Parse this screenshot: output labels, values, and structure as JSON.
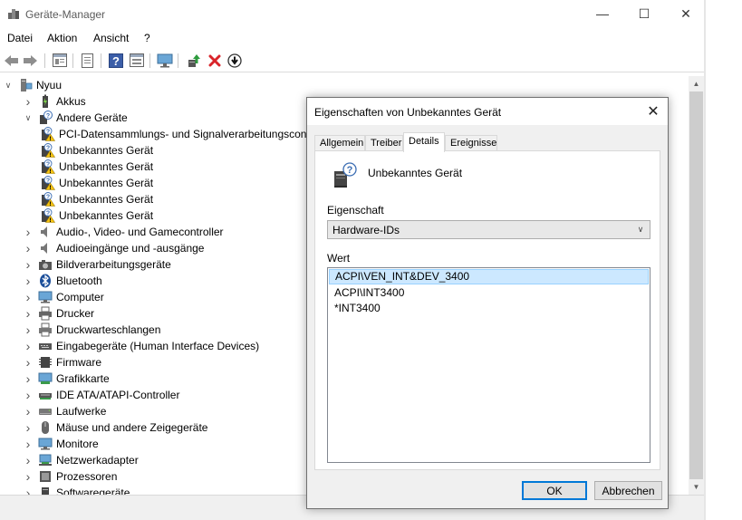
{
  "window": {
    "title": "Geräte-Manager",
    "minimize": "—",
    "maximize": "☐",
    "close": "✕"
  },
  "menu": [
    "Datei",
    "Aktion",
    "Ansicht",
    "?"
  ],
  "toolbar": [
    "back-arrow-icon",
    "forward-arrow-icon",
    "properties-view-icon",
    "document-icon",
    "help-icon",
    "update-view-icon",
    "monitor-icon",
    "driver-update-icon",
    "uninstall-x-icon",
    "download-icon"
  ],
  "tree": {
    "root": "Nyuu",
    "items": [
      {
        "label": "Akkus",
        "level": 1,
        "expanded": false
      },
      {
        "label": "Andere Geräte",
        "level": 1,
        "expanded": true
      },
      {
        "label": "PCI-Datensammlungs- und Signalverarbeitungscontroller",
        "level": 2,
        "warning": true
      },
      {
        "label": "Unbekanntes Gerät",
        "level": 2,
        "warning": true
      },
      {
        "label": "Unbekanntes Gerät",
        "level": 2,
        "warning": true
      },
      {
        "label": "Unbekanntes Gerät",
        "level": 2,
        "warning": true
      },
      {
        "label": "Unbekanntes Gerät",
        "level": 2,
        "warning": true
      },
      {
        "label": "Unbekanntes Gerät",
        "level": 2,
        "warning": true
      },
      {
        "label": "Audio-, Video- und Gamecontroller",
        "level": 1,
        "expanded": false
      },
      {
        "label": "Audioeingänge und -ausgänge",
        "level": 1,
        "expanded": false
      },
      {
        "label": "Bildverarbeitungsgeräte",
        "level": 1,
        "expanded": false
      },
      {
        "label": "Bluetooth",
        "level": 1,
        "expanded": false
      },
      {
        "label": "Computer",
        "level": 1,
        "expanded": false
      },
      {
        "label": "Drucker",
        "level": 1,
        "expanded": false
      },
      {
        "label": "Druckwarteschlangen",
        "level": 1,
        "expanded": false
      },
      {
        "label": "Eingabegeräte (Human Interface Devices)",
        "level": 1,
        "expanded": false
      },
      {
        "label": "Firmware",
        "level": 1,
        "expanded": false
      },
      {
        "label": "Grafikkarte",
        "level": 1,
        "expanded": false
      },
      {
        "label": "IDE ATA/ATAPI-Controller",
        "level": 1,
        "expanded": false
      },
      {
        "label": "Laufwerke",
        "level": 1,
        "expanded": false
      },
      {
        "label": "Mäuse und andere Zeigegeräte",
        "level": 1,
        "expanded": false
      },
      {
        "label": "Monitore",
        "level": 1,
        "expanded": false
      },
      {
        "label": "Netzwerkadapter",
        "level": 1,
        "expanded": false
      },
      {
        "label": "Prozessoren",
        "level": 1,
        "expanded": false
      },
      {
        "label": "Softwaregeräte",
        "level": 1,
        "expanded": false
      }
    ]
  },
  "dialog": {
    "title": "Eigenschaften von Unbekanntes Gerät",
    "close": "✕",
    "tabs": [
      {
        "label": "Allgemein",
        "active": false
      },
      {
        "label": "Treiber",
        "active": false
      },
      {
        "label": "Details",
        "active": true
      },
      {
        "label": "Ereignisse",
        "active": false
      }
    ],
    "device_name": "Unbekanntes Gerät",
    "property_label": "Eigenschaft",
    "property_value": "Hardware-IDs",
    "value_label": "Wert",
    "values": [
      "ACPI\\VEN_INT&DEV_3400",
      "ACPI\\INT3400",
      "*INT3400"
    ],
    "selected_index": 0,
    "ok_label": "OK",
    "cancel_label": "Abbrechen"
  }
}
